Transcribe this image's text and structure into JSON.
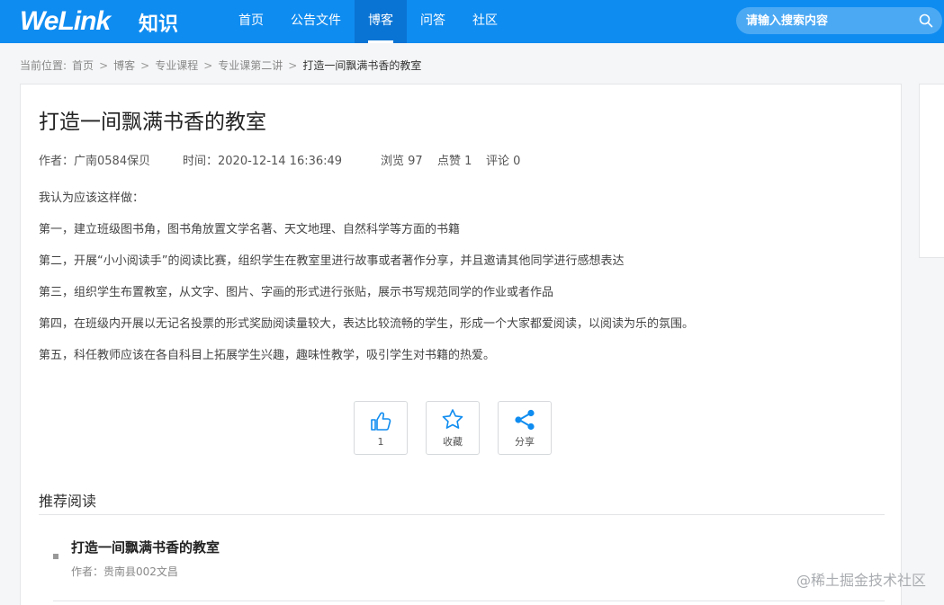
{
  "header": {
    "logo": "WeLink",
    "logo_sub": "知识",
    "nav": [
      "首页",
      "公告文件",
      "博客",
      "问答",
      "社区"
    ],
    "active_nav": "博客",
    "search_placeholder": "请输入搜索内容",
    "color": "#0f8cf0"
  },
  "breadcrumb": {
    "prefix": "当前位置:",
    "items": [
      "首页",
      "博客",
      "专业课程",
      "专业课第二讲"
    ],
    "current": "打造一间飘满书香的教室"
  },
  "article": {
    "title": "打造一间飘满书香的教室",
    "author": "作者：广南0584保贝",
    "time": "时间：2020-12-14 16:36:49",
    "views": "浏览 97",
    "likes": "点赞 1",
    "comments": "评论 0",
    "paragraphs": [
      "我认为应该这样做：",
      "第一，建立班级图书角，图书角放置文学名著、天文地理、自然科学等方面的书籍",
      "第二，开展“小小阅读手”的阅读比赛，组织学生在教室里进行故事或者著作分享，并且邀请其他同学进行感想表达",
      "第三，组织学生布置教室，从文字、图片、字画的形式进行张贴，展示书写规范同学的作业或者作品",
      "第四，在班级内开展以无记名投票的形式奖励阅读量较大，表达比较流畅的学生，形成一个大家都爱阅读，以阅读为乐的氛围。",
      "第五，科任教师应该在各自科目上拓展学生兴趣，趣味性教学，吸引学生对书籍的热爱。"
    ]
  },
  "actions": {
    "like_count": "1",
    "favorite_label": "收藏",
    "share_label": "分享",
    "icon_color": "#0f8cf0"
  },
  "recommend": {
    "heading": "推荐阅读",
    "items": [
      {
        "title": "打造一间飘满书香的教室",
        "author": "作者：贵南县002文昌"
      }
    ]
  },
  "watermark": "@稀土掘金技术社区"
}
